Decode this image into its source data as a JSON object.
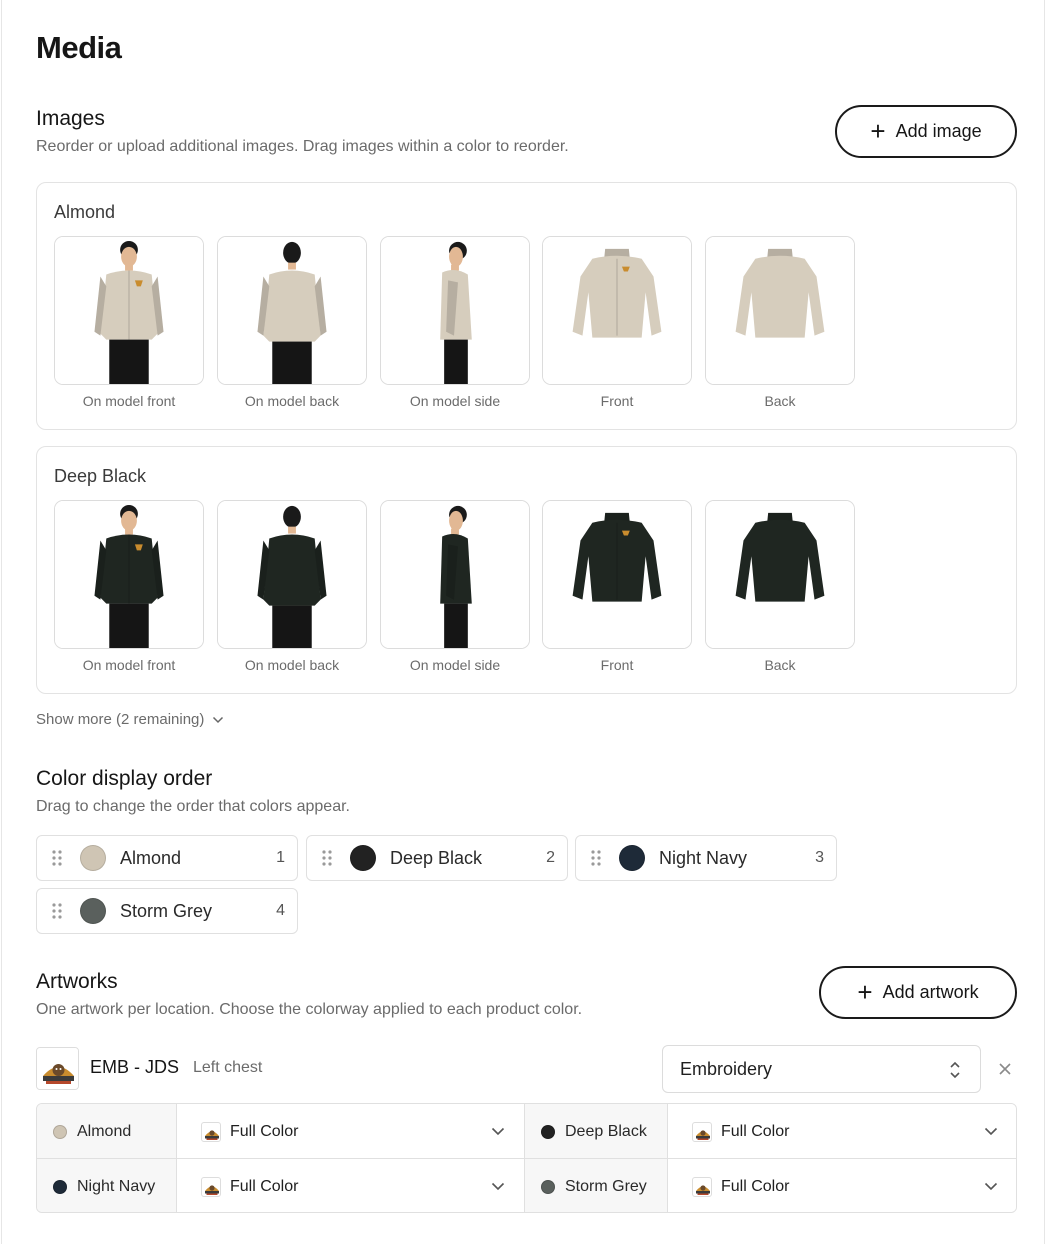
{
  "page": {
    "title": "Media"
  },
  "images": {
    "title": "Images",
    "subtitle": "Reorder or upload additional images. Drag images within a color to reorder.",
    "add_label": "Add image",
    "groups": [
      {
        "name": "Almond",
        "jacket_color": "#d6cdbd",
        "items": [
          {
            "label": "On model front"
          },
          {
            "label": "On model back"
          },
          {
            "label": "On model side"
          },
          {
            "label": "Front"
          },
          {
            "label": "Back"
          }
        ]
      },
      {
        "name": "Deep Black",
        "jacket_color": "#1f2621",
        "items": [
          {
            "label": "On model front"
          },
          {
            "label": "On model back"
          },
          {
            "label": "On model side"
          },
          {
            "label": "Front"
          },
          {
            "label": "Back"
          }
        ]
      }
    ],
    "show_more": "Show more (2 remaining)"
  },
  "color_order": {
    "title": "Color display order",
    "subtitle": "Drag to change the order that colors appear.",
    "colors": [
      {
        "name": "Almond",
        "position": "1",
        "swatch": "#cfc5b4"
      },
      {
        "name": "Deep Black",
        "position": "2",
        "swatch": "#222222"
      },
      {
        "name": "Night Navy",
        "position": "3",
        "swatch": "#1e2a38"
      },
      {
        "name": "Storm Grey",
        "position": "4",
        "swatch": "#5a605d"
      }
    ]
  },
  "artworks": {
    "title": "Artworks",
    "subtitle": "One artwork per location. Choose the colorway applied to each product color.",
    "add_label": "Add artwork",
    "artwork": {
      "name": "EMB - JDS",
      "location": "Left chest",
      "decoration_method": "Embroidery"
    },
    "colorways": [
      {
        "color": "Almond",
        "swatch": "#cfc5b4",
        "colorway": "Full Color"
      },
      {
        "color": "Deep Black",
        "swatch": "#222222",
        "colorway": "Full Color"
      },
      {
        "color": "Night Navy",
        "swatch": "#1e2a38",
        "colorway": "Full Color"
      },
      {
        "color": "Storm Grey",
        "swatch": "#5a605d",
        "colorway": "Full Color"
      }
    ]
  },
  "icons": {
    "add": "plus-icon",
    "drag": "drag-handle-icon",
    "expand": "chevron-down-icon",
    "select": "updown-icon",
    "remove": "close-icon"
  }
}
